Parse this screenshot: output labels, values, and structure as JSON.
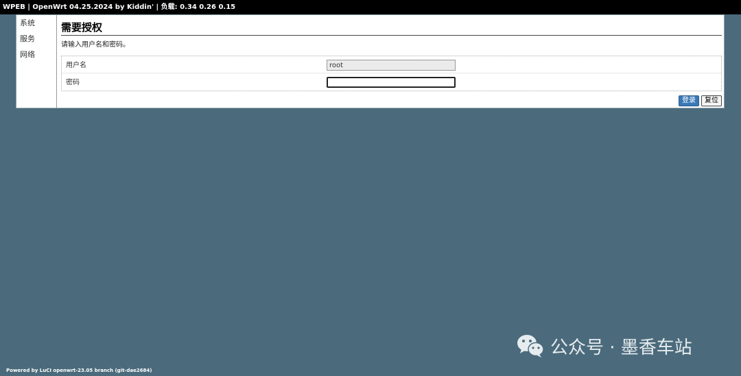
{
  "header": {
    "title": "WPEB | OpenWrt 04.25.2024 by Kiddin' | 负载: 0.34 0.26 0.15"
  },
  "sidebar": {
    "items": [
      {
        "label": "系统"
      },
      {
        "label": "服务"
      },
      {
        "label": "网络"
      }
    ]
  },
  "main": {
    "title": "需要授权",
    "description": "请输入用户名和密码。",
    "fields": {
      "username": {
        "label": "用户名",
        "value": "root"
      },
      "password": {
        "label": "密码",
        "value": ""
      }
    },
    "buttons": {
      "login": "登录",
      "reset": "复位"
    }
  },
  "footer": {
    "text": "Powered by LuCI openwrt-23.05 branch (git-dae2684)"
  },
  "watermark": {
    "text": "公众号 · 墨香车站",
    "icon": "wechat-icon"
  },
  "colors": {
    "background": "#4b6b7c",
    "topbar": "#000000",
    "login_button": "#3a78b5"
  }
}
